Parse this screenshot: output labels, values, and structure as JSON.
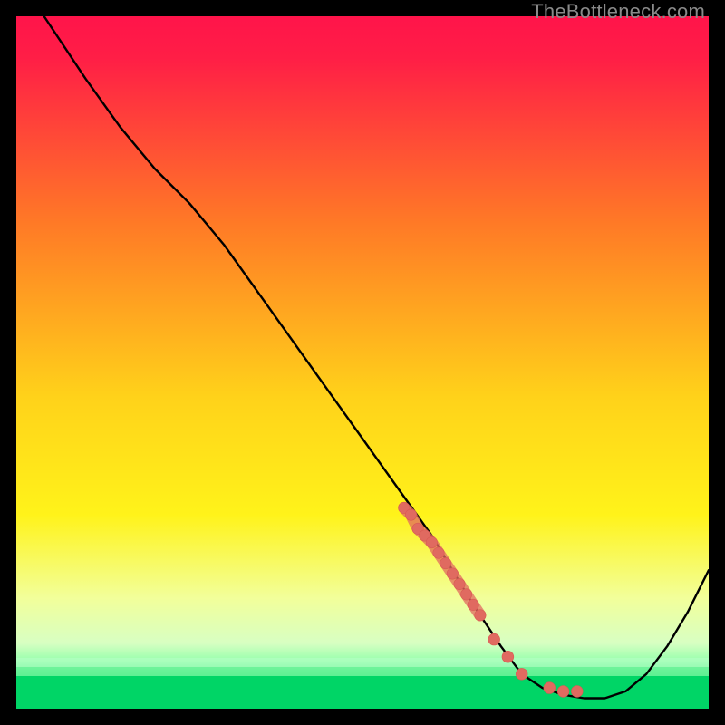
{
  "watermark": "TheBottleneck.com",
  "colors": {
    "gradient_top": "#ff144a",
    "gradient_mid1": "#ff8a1f",
    "gradient_mid2": "#ffe21a",
    "gradient_mid3": "#f6ff8f",
    "gradient_bottom_band": "#e8ffd0",
    "gradient_green": "#00e36a",
    "curve": "#000000",
    "marker_fill": "#e06a60",
    "marker_stroke": "#d85a52"
  },
  "chart_data": {
    "type": "line",
    "title": "",
    "xlabel": "",
    "ylabel": "",
    "xlim": [
      0,
      100
    ],
    "ylim": [
      0,
      100
    ],
    "grid": false,
    "legend": false,
    "series": [
      {
        "name": "bottleneck-curve",
        "x": [
          4,
          10,
          15,
          20,
          25,
          30,
          35,
          40,
          45,
          50,
          55,
          60,
          63,
          66,
          70,
          73,
          76,
          79,
          82,
          85,
          88,
          91,
          94,
          97,
          100
        ],
        "y": [
          100,
          91,
          84,
          78,
          73,
          67,
          60,
          53,
          46,
          39,
          32,
          25,
          20,
          15,
          9,
          5,
          3,
          2,
          1.5,
          1.5,
          2.5,
          5,
          9,
          14,
          20
        ]
      }
    ],
    "markers": {
      "name": "highlight-dots",
      "x": [
        56,
        57,
        58,
        59,
        60,
        61,
        62,
        63,
        64,
        65,
        66,
        67,
        69,
        71,
        73,
        77,
        79,
        81
      ],
      "y": [
        29,
        28,
        26,
        25,
        24,
        22.5,
        21,
        19.5,
        18,
        16.5,
        15,
        13.5,
        10,
        7.5,
        5,
        3,
        2.5,
        2.5
      ]
    }
  }
}
